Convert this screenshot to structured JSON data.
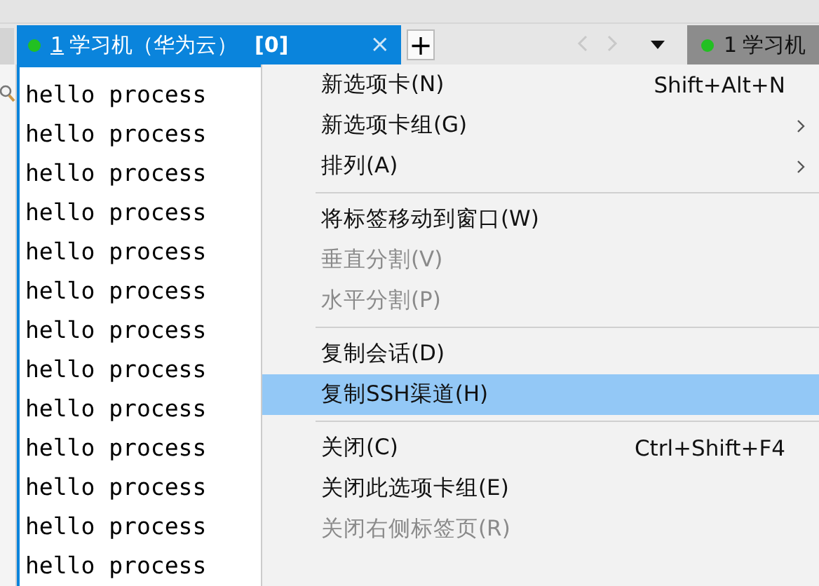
{
  "tabs": [
    {
      "number": "1",
      "title": "学习机（华为云）",
      "count": "[0]",
      "close": "×",
      "selected": true,
      "connected": true
    },
    {
      "number": "1",
      "title": "学习机",
      "selected": false,
      "connected": true
    }
  ],
  "new_tab_button": "+",
  "terminal": {
    "lines": [
      "hello process",
      "hello process",
      "hello process",
      "hello process",
      "hello process",
      "hello process",
      "hello process",
      "hello process",
      "hello process",
      "hello process",
      "hello process",
      "hello process",
      "hello process"
    ]
  },
  "context_menu": {
    "items": [
      {
        "kind": "item",
        "label": "新选项卡(N)",
        "shortcut": "Shift+Alt+N",
        "disabled": false,
        "selected": false
      },
      {
        "kind": "submenu",
        "label": "新选项卡组(G)",
        "disabled": false,
        "selected": false
      },
      {
        "kind": "submenu",
        "label": "排列(A)",
        "disabled": false,
        "selected": false
      },
      {
        "kind": "separator"
      },
      {
        "kind": "item",
        "label": "将标签移动到窗口(W)",
        "disabled": false,
        "selected": false
      },
      {
        "kind": "item",
        "label": "垂直分割(V)",
        "disabled": true,
        "selected": false
      },
      {
        "kind": "item",
        "label": "水平分割(P)",
        "disabled": true,
        "selected": false
      },
      {
        "kind": "separator"
      },
      {
        "kind": "item",
        "label": "复制会话(D)",
        "disabled": false,
        "selected": false
      },
      {
        "kind": "item",
        "label": "复制SSH渠道(H)",
        "disabled": false,
        "selected": true
      },
      {
        "kind": "separator"
      },
      {
        "kind": "item",
        "label": "关闭(C)",
        "shortcut": "Ctrl+Shift+F4",
        "disabled": false,
        "selected": false
      },
      {
        "kind": "item",
        "label": "关闭此选项卡组(E)",
        "disabled": false,
        "selected": false
      },
      {
        "kind": "item",
        "label": "关闭右侧标签页(R)",
        "disabled": true,
        "selected": false
      }
    ]
  }
}
